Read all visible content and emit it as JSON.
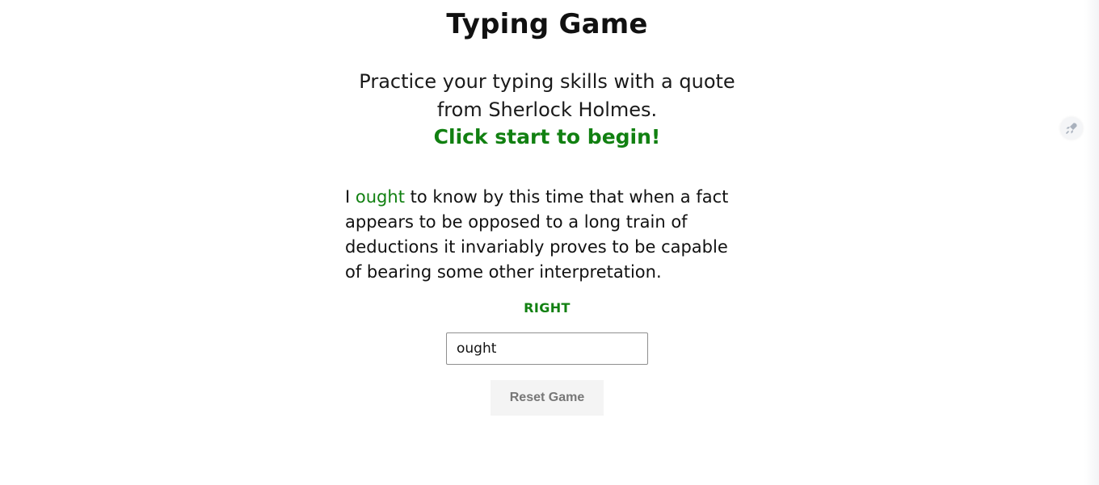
{
  "header": {
    "title": "Typing Game"
  },
  "intro": {
    "line1": "Practice your typing skills with a quote",
    "line2": "from Sherlock Holmes.",
    "start_prompt": "Click start to begin!"
  },
  "quote": {
    "word_before": "I",
    "current_word": "ought",
    "rest": "to know by this time that when a fact appears to be opposed to a long train of deductions it invariably proves to be capable of bearing some other interpretation."
  },
  "feedback": {
    "status": "RIGHT"
  },
  "input": {
    "value": "ought"
  },
  "controls": {
    "reset_label": "Reset Game"
  },
  "colors": {
    "accent_green": "#118011",
    "button_bg": "#f4f4f4",
    "button_text": "#777777"
  },
  "icons": {
    "side_widget": "rocket-icon"
  }
}
